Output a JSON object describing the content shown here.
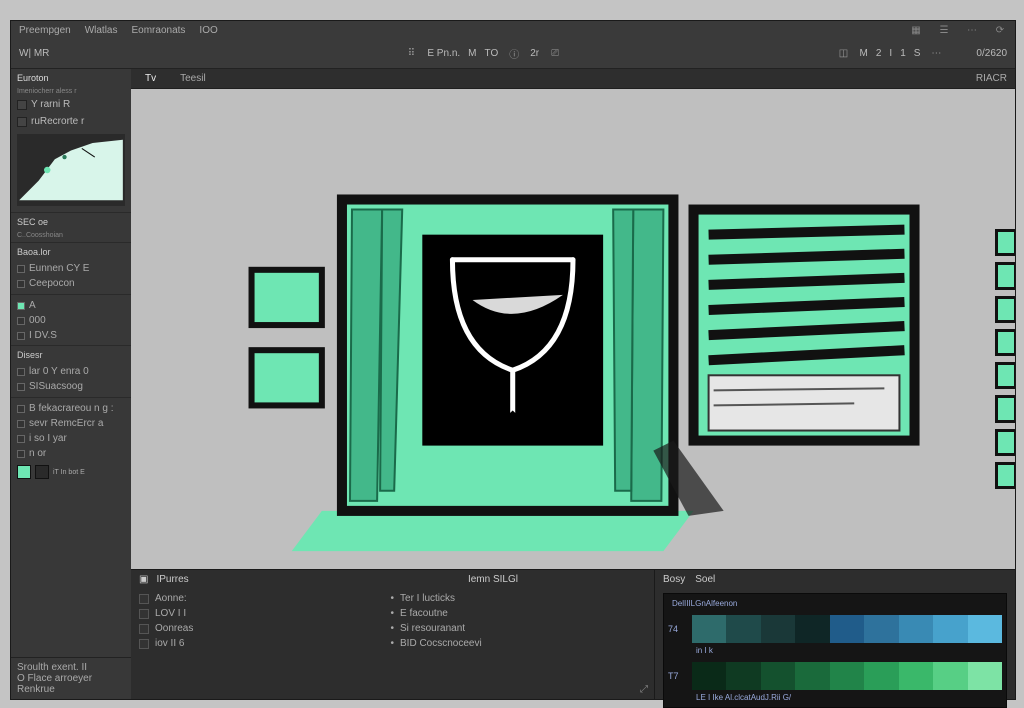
{
  "menubar": {
    "items": [
      "Preempgen",
      "Wlatlas",
      "Eomraonats",
      "IOO"
    ],
    "right_icons": [
      "grid-icon",
      "layers-icon",
      "menu-icon",
      "sync-icon"
    ]
  },
  "toolbar": {
    "mode_label": "MR",
    "lead": "W|",
    "center_items": [
      "E Pn.n.",
      "M",
      "TO",
      "i",
      "2r"
    ],
    "right_items": [
      "M",
      "2",
      "I",
      "1",
      "S"
    ],
    "status": "0/2620"
  },
  "tabs": {
    "items": [
      "Tv",
      "Teesil"
    ],
    "active_index": 0,
    "right": "RIACR"
  },
  "left_panel": {
    "title": "Euroton",
    "subtitle": "Imeniocherr aless r",
    "rows": [
      "Y rarni R",
      "ruRecrorte r"
    ],
    "section1": {
      "title": "SEC oe",
      "sub": "C..Coosshoian"
    },
    "basics": {
      "title": "Baoa.lor",
      "items": [
        "Eunnen CY E",
        "Ceepocon"
      ]
    },
    "anchors": {
      "items": [
        "A",
        "000",
        "I DV.S"
      ]
    },
    "groups": {
      "title": "Disesr",
      "items": [
        "lar 0 Y enra 0",
        "SISuacsoog"
      ]
    },
    "layers_title": "",
    "layers": [
      "B fekacrareou n g :",
      "sevr RemcErcr a",
      "i so I yar",
      "n or"
    ],
    "swatches": [
      "#6ee6b3",
      "#2a2a2a"
    ],
    "swatch_label": "iT In bot E",
    "footer": [
      "Sroulth exent. II",
      "O Flace arroeyer",
      "Renkrue"
    ]
  },
  "bottom_left": {
    "title": "IPurres",
    "col1": [
      "Aonne:",
      "LOV  I I",
      "Oonreas",
      "iov II 6"
    ],
    "col2_title": "Iemn SILGl",
    "col2": [
      "Ter I lucticks",
      "E  facoutne",
      "Si resouranant",
      "BID Cocscnoceevi"
    ]
  },
  "bottom_right": {
    "tabs": [
      "Bosy",
      "Soel"
    ],
    "line_title": "DelIIILGnAlfeenon",
    "track1_label": "74",
    "track1_text": "in I k",
    "track2_label": "T7",
    "track2_text": "LE  I Ike Al.clcatAudJ.Rii G/",
    "palette1": [
      "#2e6b6b",
      "#1f4a4a",
      "#1a3838",
      "#0f2626",
      "#205c8a",
      "#2e729c",
      "#398ab4",
      "#47a2cc",
      "#5bb9df"
    ],
    "palette2": [
      "#0a2a18",
      "#0f3a22",
      "#14512e",
      "#1a6a3b",
      "#218449",
      "#2a9e58",
      "#3ab86a",
      "#57cf85",
      "#7de3a5"
    ]
  },
  "colors": {
    "accent": "#6ee6b3",
    "panel": "#383838",
    "canvas": "#bfbfbf"
  }
}
